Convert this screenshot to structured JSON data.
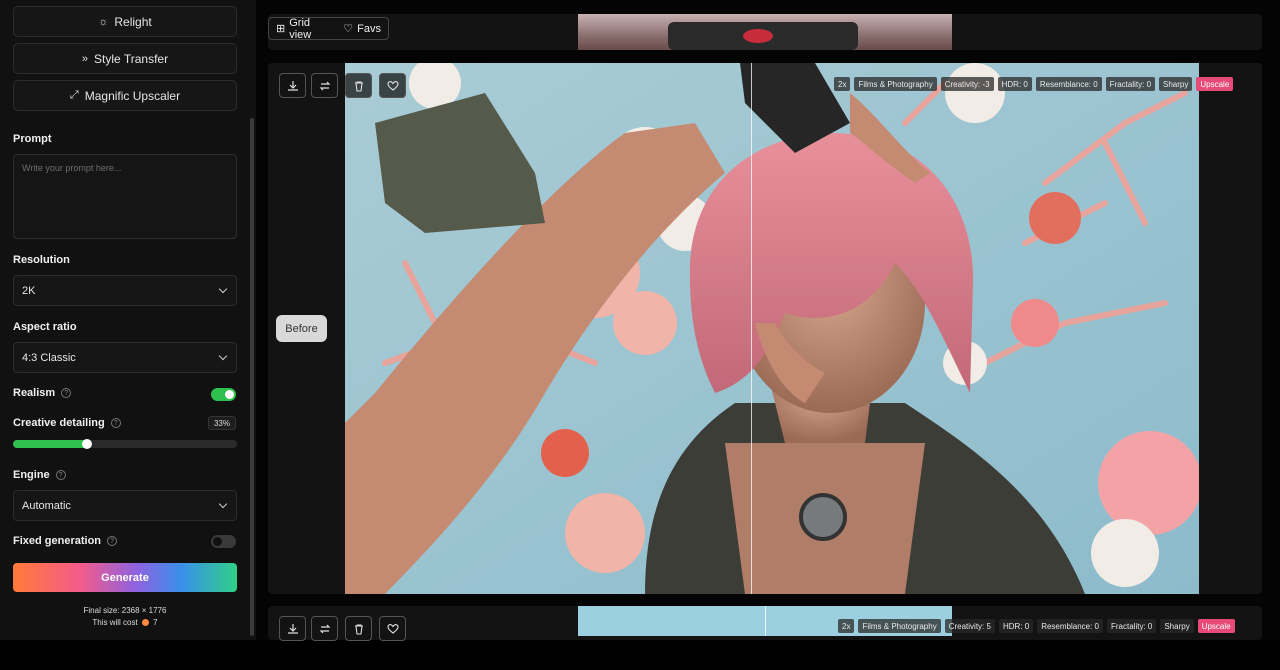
{
  "sidebar": {
    "tools": [
      {
        "label": "Relight",
        "icon": "sun-icon"
      },
      {
        "label": "Style Transfer",
        "icon": "double-chevron-icon"
      },
      {
        "label": "Magnific Upscaler",
        "icon": "expand-icon"
      }
    ],
    "prompt": {
      "label": "Prompt",
      "placeholder": "Write your prompt here..."
    },
    "resolution": {
      "label": "Resolution",
      "value": "2K"
    },
    "aspect_ratio": {
      "label": "Aspect ratio",
      "value": "4:3 Classic"
    },
    "realism": {
      "label": "Realism",
      "on": true
    },
    "creative_detailing": {
      "label": "Creative detailing",
      "value_label": "33%",
      "value": 0.33
    },
    "engine": {
      "label": "Engine",
      "value": "Automatic"
    },
    "fixed_generation": {
      "label": "Fixed generation",
      "on": false
    },
    "generate_label": "Generate",
    "final_size": "Final size: 2368 × 1776",
    "cost_prefix": "This will cost",
    "cost_value": "7"
  },
  "toolbar": {
    "grid_view": "Grid view",
    "favs": "Favs"
  },
  "comparison": {
    "before_label": "Before"
  },
  "result1_tags": [
    "2x",
    "Films & Photography",
    "Creativity: -3",
    "HDR: 0",
    "Resemblance: 0",
    "Fractality: 0",
    "Sharpy",
    "Upscale"
  ],
  "result2_tags": [
    "2x",
    "Films & Photography",
    "Creativity: 5",
    "HDR: 0",
    "Resemblance: 0",
    "Fractality: 0",
    "Sharpy",
    "Upscale"
  ],
  "colors": {
    "accent_green": "#2fc14d",
    "upscale_pink": "#e84a77"
  }
}
